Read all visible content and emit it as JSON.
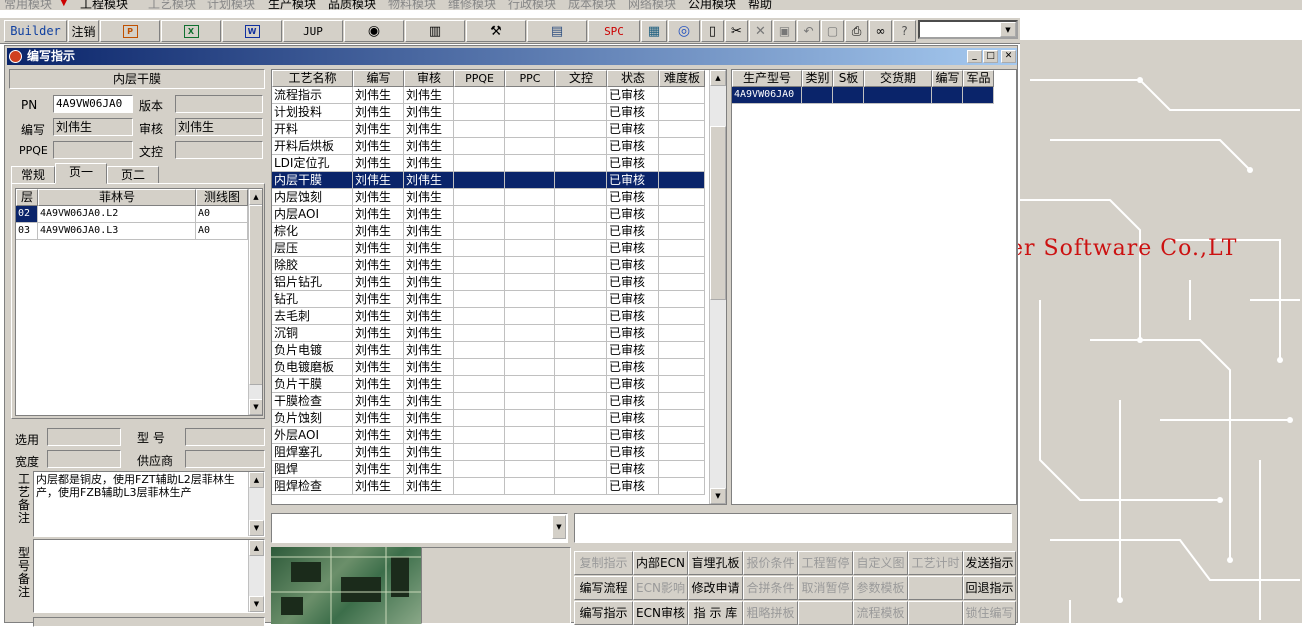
{
  "menu": [
    "常用模块",
    "工程模块",
    "工艺模块",
    "计划模块",
    "生产模块",
    "品质模块",
    "物料模块",
    "维修模块",
    "行政模块",
    "成本模块",
    "网络模块",
    "公用模块",
    "帮助"
  ],
  "toolbar": {
    "builder": "Builder",
    "logout": "注销",
    "jup": "JUP",
    "spc": "SPC",
    "icons": [
      "ppt-icon",
      "excel-icon",
      "word-icon",
      "jup-button",
      "eye-icon",
      "cabinet-icon",
      "tools-icon",
      "printer-icon",
      "spc-button",
      "calculator-icon",
      "globe-icon",
      "new-doc-icon",
      "cut-icon",
      "close-icon",
      "save-icon",
      "undo-icon",
      "preview-icon",
      "print-icon",
      "binoculars-icon",
      "help-icon"
    ]
  },
  "background_text": "er Software Co.,LT",
  "window": {
    "title": "编写指示"
  },
  "left": {
    "heading": "内层干膜",
    "fields": [
      {
        "label": "PN",
        "value": "4A9VW06JA0"
      },
      {
        "label": "版本",
        "value": ""
      },
      {
        "label": "编写",
        "value": "刘伟生"
      },
      {
        "label": "审核",
        "value": "刘伟生"
      },
      {
        "label": "PPQE",
        "value": ""
      },
      {
        "label": "文控",
        "value": ""
      }
    ],
    "tabs": [
      "常规",
      "页一",
      "页二"
    ],
    "layer_grid": {
      "headers": [
        "层",
        "菲林号",
        "测线图"
      ],
      "rows": [
        [
          "02",
          "4A9VW06JA0.L2",
          "A0"
        ],
        [
          "03",
          "4A9VW06JA0.L3",
          "A0"
        ]
      ]
    },
    "lower_fields": [
      {
        "label": "选用",
        "value": ""
      },
      {
        "label": "型 号",
        "value": ""
      },
      {
        "label": "宽度",
        "value": ""
      },
      {
        "label": "供应商",
        "value": ""
      }
    ],
    "process_note_label": "工艺备注",
    "process_note": "内层都是铜皮，使用FZT辅助L2层菲林生产，使用FZB辅助L3层菲林生产",
    "model_note_label": "型号备注"
  },
  "process_grid": {
    "headers": [
      "工艺名称",
      "编写",
      "审核",
      "PPQE",
      "PPC",
      "文控",
      "状态",
      "难度板"
    ],
    "rows": [
      [
        "流程指示",
        "刘伟生",
        "刘伟生",
        "",
        "",
        "",
        "已审核",
        ""
      ],
      [
        "计划投料",
        "刘伟生",
        "刘伟生",
        "",
        "",
        "",
        "已审核",
        ""
      ],
      [
        "开料",
        "刘伟生",
        "刘伟生",
        "",
        "",
        "",
        "已审核",
        ""
      ],
      [
        "开料后烘板",
        "刘伟生",
        "刘伟生",
        "",
        "",
        "",
        "已审核",
        ""
      ],
      [
        "LDI定位孔",
        "刘伟生",
        "刘伟生",
        "",
        "",
        "",
        "已审核",
        ""
      ],
      [
        "内层干膜",
        "刘伟生",
        "刘伟生",
        "",
        "",
        "",
        "已审核",
        ""
      ],
      [
        "内层蚀刻",
        "刘伟生",
        "刘伟生",
        "",
        "",
        "",
        "已审核",
        ""
      ],
      [
        "内层AOI",
        "刘伟生",
        "刘伟生",
        "",
        "",
        "",
        "已审核",
        ""
      ],
      [
        "棕化",
        "刘伟生",
        "刘伟生",
        "",
        "",
        "",
        "已审核",
        ""
      ],
      [
        "层压",
        "刘伟生",
        "刘伟生",
        "",
        "",
        "",
        "已审核",
        ""
      ],
      [
        "除胶",
        "刘伟生",
        "刘伟生",
        "",
        "",
        "",
        "已审核",
        ""
      ],
      [
        "铝片钻孔",
        "刘伟生",
        "刘伟生",
        "",
        "",
        "",
        "已审核",
        ""
      ],
      [
        "钻孔",
        "刘伟生",
        "刘伟生",
        "",
        "",
        "",
        "已审核",
        ""
      ],
      [
        "去毛刺",
        "刘伟生",
        "刘伟生",
        "",
        "",
        "",
        "已审核",
        ""
      ],
      [
        "沉铜",
        "刘伟生",
        "刘伟生",
        "",
        "",
        "",
        "已审核",
        ""
      ],
      [
        "负片电镀",
        "刘伟生",
        "刘伟生",
        "",
        "",
        "",
        "已审核",
        ""
      ],
      [
        "负电镀磨板",
        "刘伟生",
        "刘伟生",
        "",
        "",
        "",
        "已审核",
        ""
      ],
      [
        "负片干膜",
        "刘伟生",
        "刘伟生",
        "",
        "",
        "",
        "已审核",
        ""
      ],
      [
        "干膜检查",
        "刘伟生",
        "刘伟生",
        "",
        "",
        "",
        "已审核",
        ""
      ],
      [
        "负片蚀刻",
        "刘伟生",
        "刘伟生",
        "",
        "",
        "",
        "已审核",
        ""
      ],
      [
        "外层AOI",
        "刘伟生",
        "刘伟生",
        "",
        "",
        "",
        "已审核",
        ""
      ],
      [
        "阻焊塞孔",
        "刘伟生",
        "刘伟生",
        "",
        "",
        "",
        "已审核",
        ""
      ],
      [
        "阻焊",
        "刘伟生",
        "刘伟生",
        "",
        "",
        "",
        "已审核",
        ""
      ],
      [
        "阻焊检查",
        "刘伟生",
        "刘伟生",
        "",
        "",
        "",
        "已审核",
        ""
      ]
    ],
    "selected": 5
  },
  "product_grid": {
    "headers": [
      "生产型号",
      "类别",
      "S板",
      "交货期",
      "编写",
      "军品"
    ],
    "rows": [
      [
        "4A9VW06JA0",
        "",
        "",
        "",
        "",
        ""
      ]
    ]
  },
  "buttons": [
    [
      "复制指示",
      "内部ECN",
      "盲埋孔板",
      "报价条件",
      "工程暂停",
      "自定义图",
      "工艺计时",
      "发送指示"
    ],
    [
      "编写流程",
      "ECN影响",
      "修改申请",
      "合拼条件",
      "取消暂停",
      "参数模板",
      "",
      "回退指示"
    ],
    [
      "编写指示",
      "ECN审核",
      "指 示 库",
      "粗略拼板",
      "",
      "流程模板",
      "",
      "锁住编写"
    ]
  ],
  "buttons_disabled": [
    [
      true,
      false,
      false,
      true,
      true,
      true,
      true,
      false
    ],
    [
      false,
      true,
      false,
      true,
      true,
      true,
      false,
      false
    ],
    [
      false,
      false,
      false,
      true,
      false,
      true,
      false,
      true
    ]
  ]
}
